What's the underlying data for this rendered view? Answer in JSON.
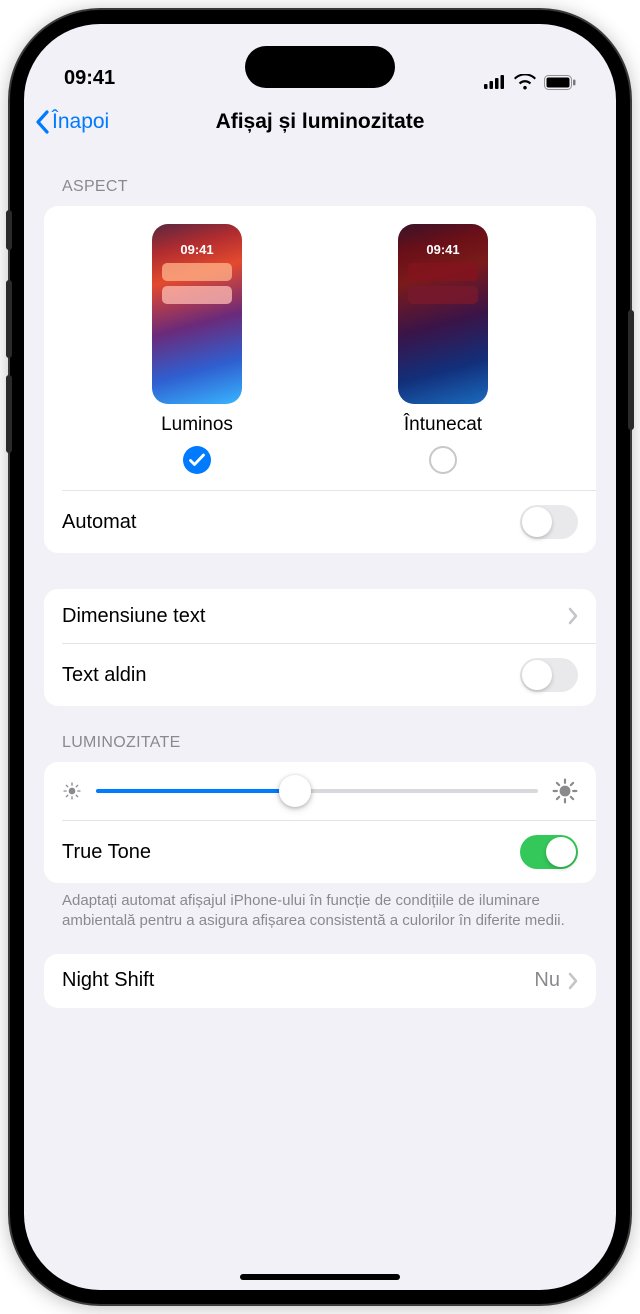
{
  "status": {
    "time": "09:41"
  },
  "nav": {
    "back_label": "Înapoi",
    "title": "Afișaj și luminozitate"
  },
  "appearance": {
    "header": "ASPECT",
    "preview_time": "09:41",
    "light_label": "Luminos",
    "dark_label": "Întunecat",
    "selected": "light"
  },
  "rows": {
    "automatic_label": "Automat",
    "automatic_on": false,
    "text_size_label": "Dimensiune text",
    "bold_text_label": "Text aldin",
    "bold_text_on": false
  },
  "brightness": {
    "header": "LUMINOZITATE",
    "value_percent": 45,
    "true_tone_label": "True Tone",
    "true_tone_on": true,
    "footer": "Adaptați automat afișajul iPhone-ului în funcție de condițiile de iluminare ambientală pentru a asigura afișarea consistentă a culorilor în diferite medii."
  },
  "night_shift": {
    "label": "Night Shift",
    "value": "Nu"
  }
}
